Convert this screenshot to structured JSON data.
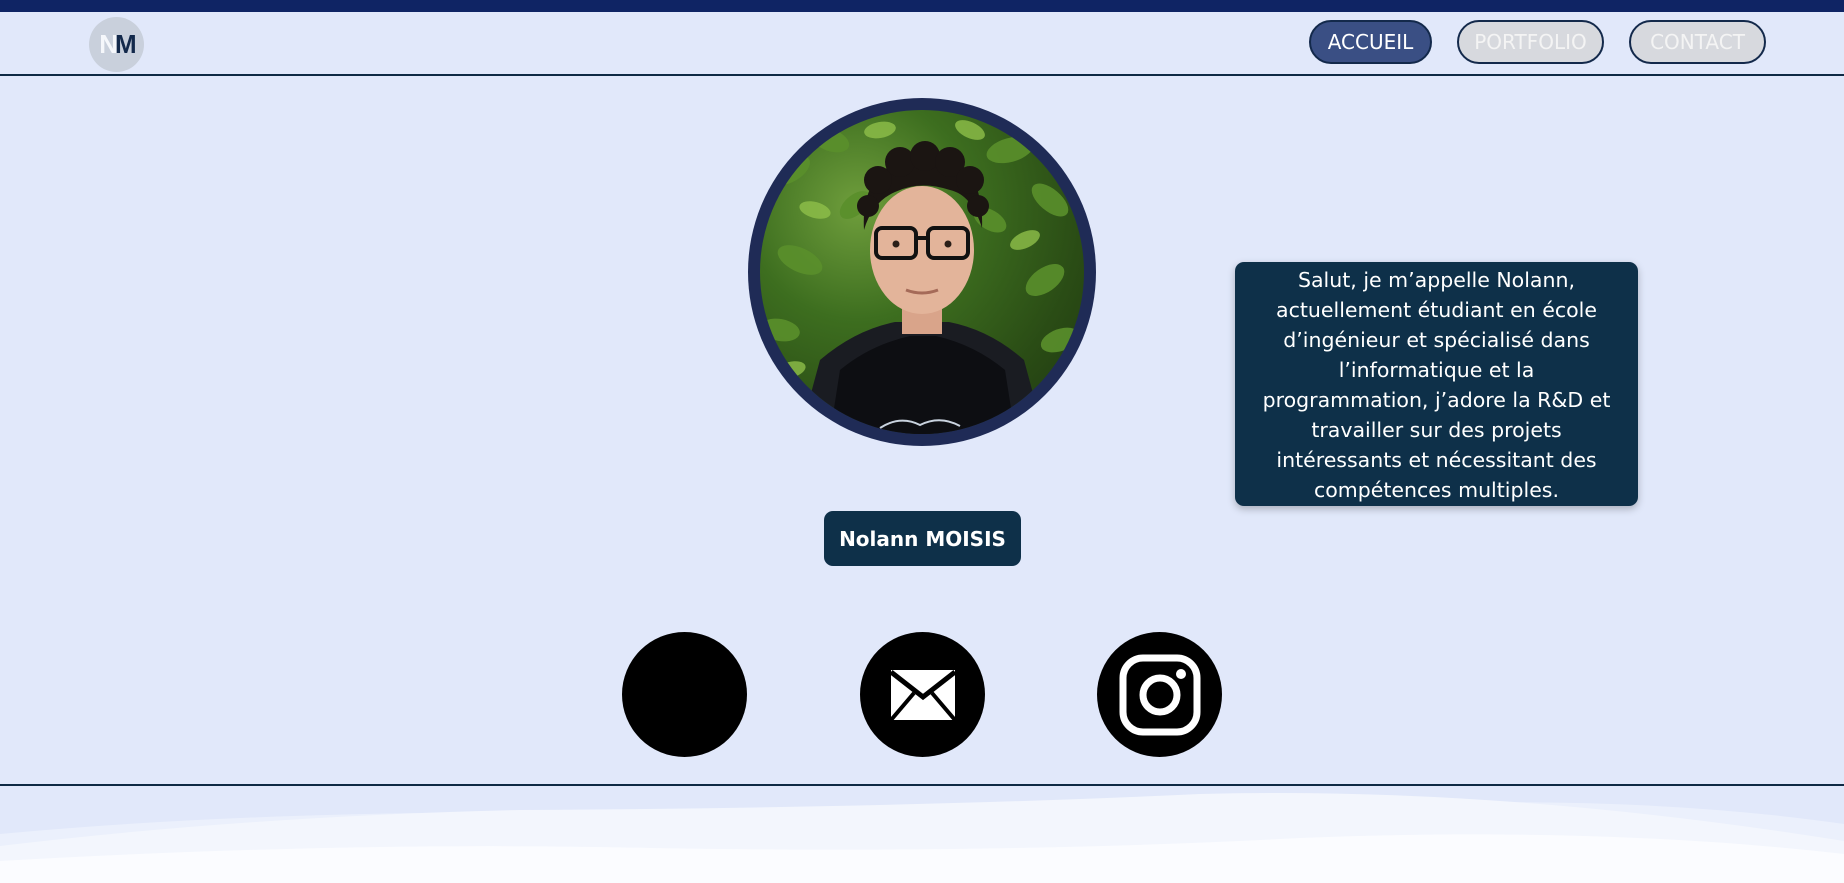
{
  "logo": {
    "letter_1": "N",
    "letter_2": "M"
  },
  "nav": {
    "items": [
      {
        "label": "ACCUEIL",
        "active": true
      },
      {
        "label": "PORTFOLIO",
        "active": false
      },
      {
        "label": "CONTACT",
        "active": false
      }
    ]
  },
  "profile": {
    "name": "Nolann MOISIS",
    "bio": "Salut, je m’appelle Nolann, actuellement étudiant en école d’ingénieur et spécialisé dans l’informatique et la programmation, j’adore la R&D et travailler sur des projets intéressants et nécessitant des compétences multiples."
  },
  "socials": [
    {
      "icon": "github-icon"
    },
    {
      "icon": "mail-icon"
    },
    {
      "icon": "instagram-icon"
    }
  ],
  "colors": {
    "background": "#e1e8fa",
    "navy": "#0f2464",
    "card": "#0e3049",
    "active_nav": "#3a4f84",
    "inactive_nav": "#d7d9de"
  }
}
